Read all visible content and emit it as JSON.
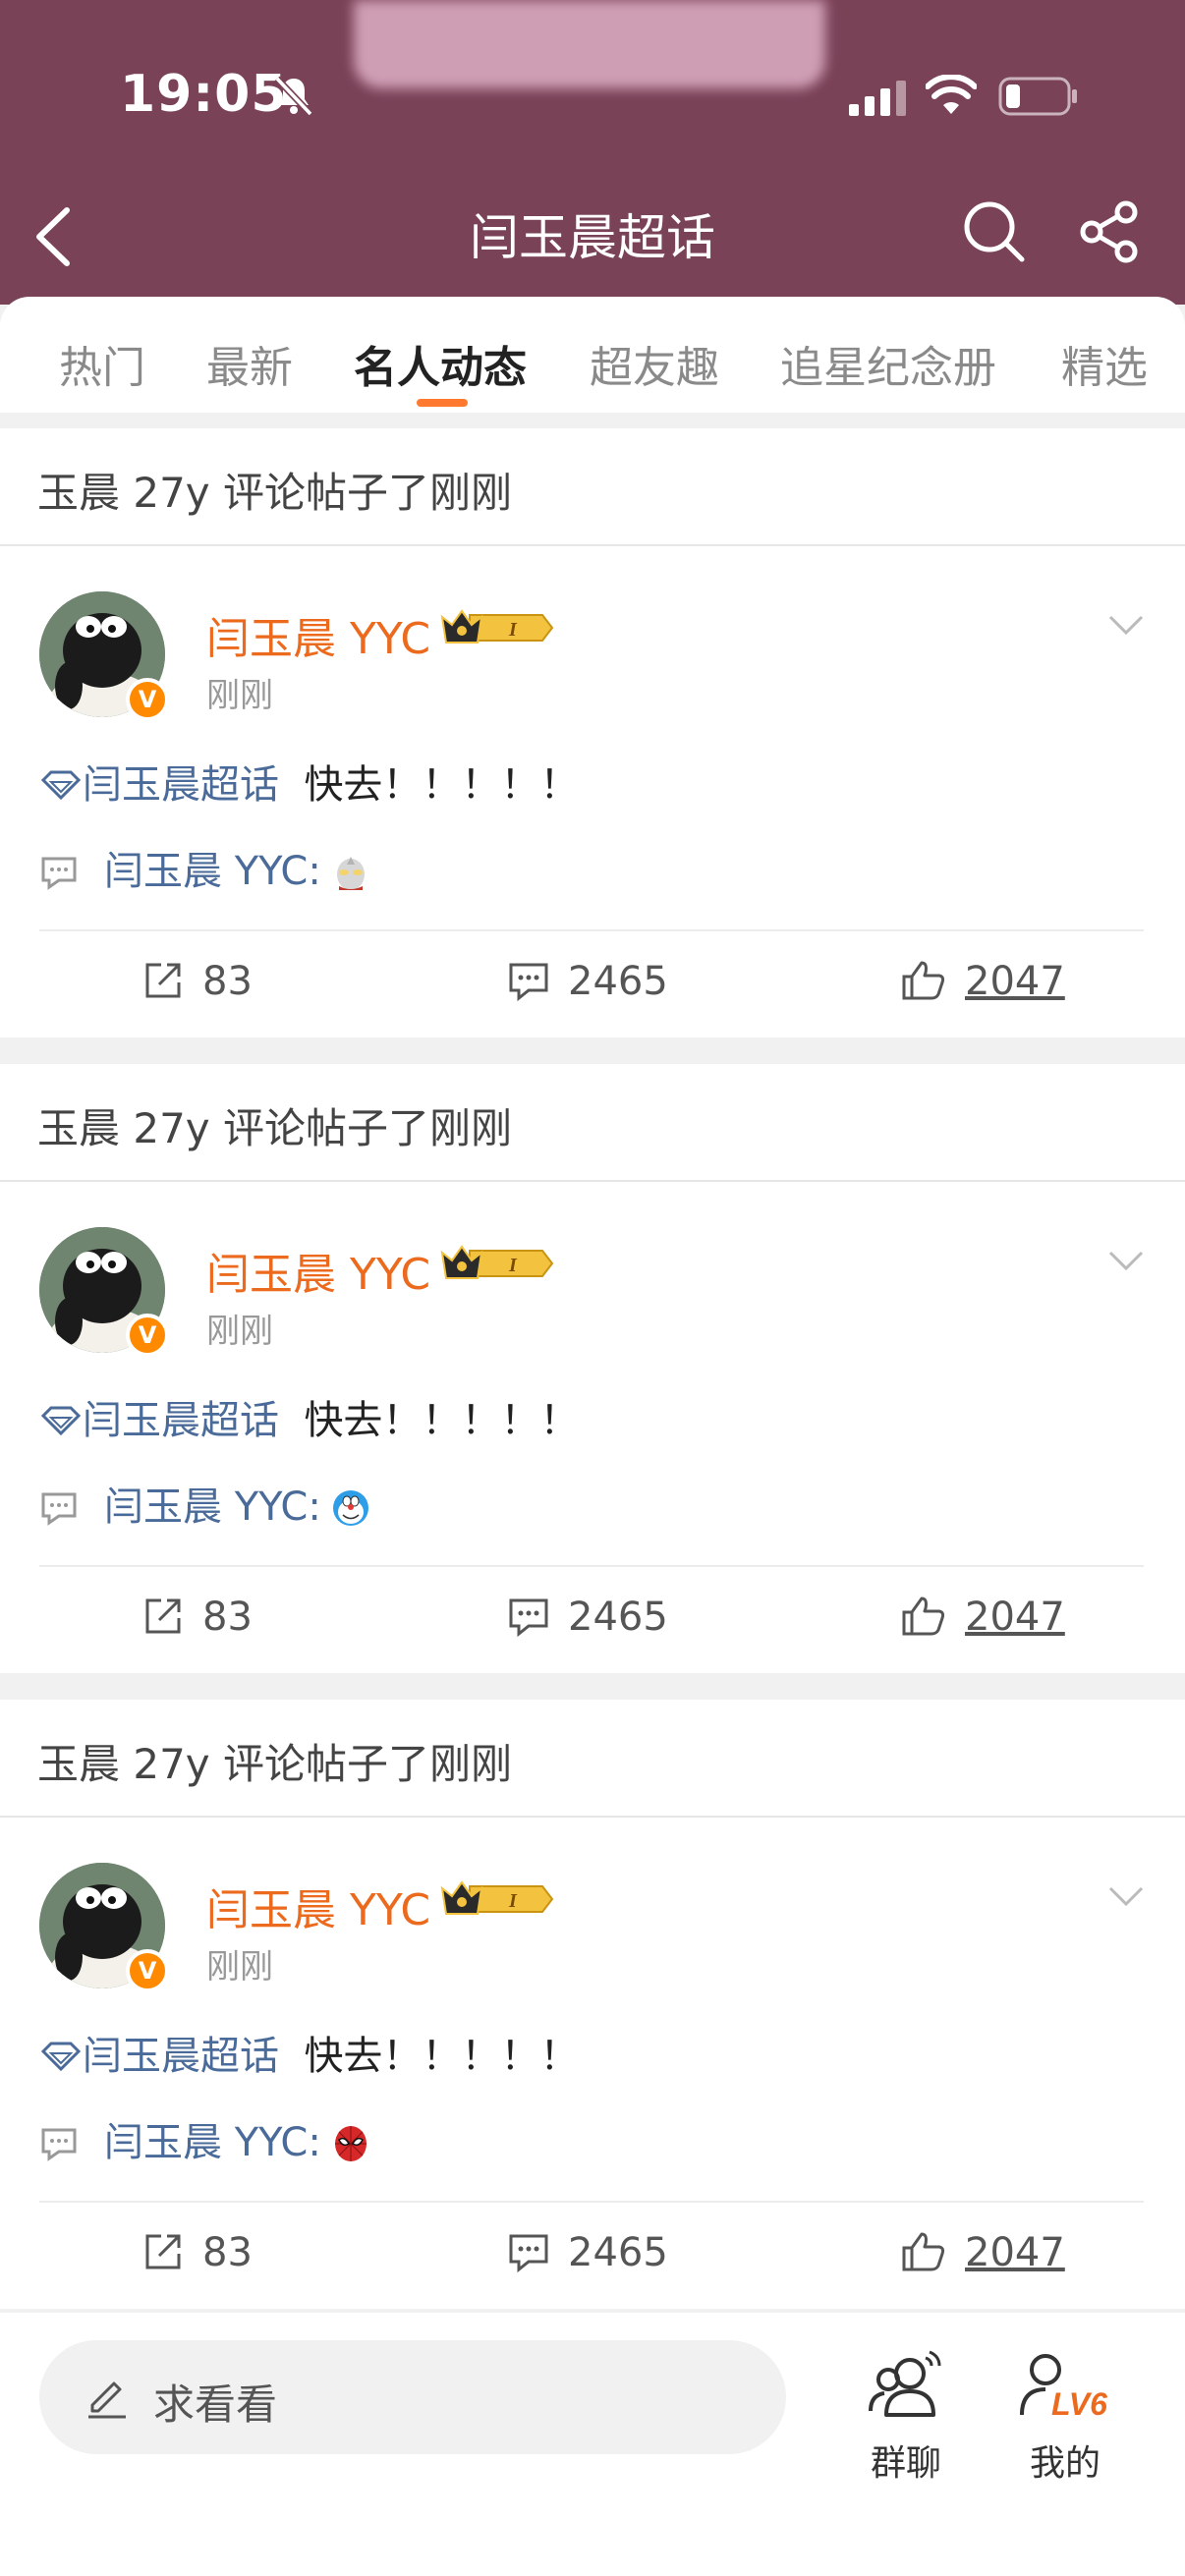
{
  "status_bar": {
    "time": "19:05"
  },
  "header": {
    "title": "闫玉晨超话"
  },
  "tabs": [
    {
      "label": "热门",
      "active": false
    },
    {
      "label": "最新",
      "active": false
    },
    {
      "label": "名人动态",
      "active": true
    },
    {
      "label": "超友趣",
      "active": false
    },
    {
      "label": "追星纪念册",
      "active": false
    },
    {
      "label": "精选",
      "active": false
    }
  ],
  "posts": [
    {
      "heading": "玉晨 27y 评论帖子了刚刚",
      "author": "闫玉晨 YYC",
      "time": "刚刚",
      "topic": "闫玉晨超话",
      "text": "快去！！！！！",
      "comment_author": "闫玉晨 YYC:",
      "emoji": "ultraman",
      "reposts": "83",
      "comments": "2465",
      "likes": "2047"
    },
    {
      "heading": "玉晨 27y 评论帖子了刚刚",
      "author": "闫玉晨 YYC",
      "time": "刚刚",
      "topic": "闫玉晨超话",
      "text": "快去！！！！！",
      "comment_author": "闫玉晨 YYC:",
      "emoji": "doraemon",
      "reposts": "83",
      "comments": "2465",
      "likes": "2047"
    },
    {
      "heading": "玉晨 27y 评论帖子了刚刚",
      "author": "闫玉晨 YYC",
      "time": "刚刚",
      "topic": "闫玉晨超话",
      "text": "快去！！！！！",
      "comment_author": "闫玉晨 YYC:",
      "emoji": "spiderman",
      "reposts": "83",
      "comments": "2465",
      "likes": "2047"
    }
  ],
  "bottom_bar": {
    "ask_placeholder": "求看看",
    "group_chat": "群聊",
    "mine": "我的",
    "level_badge": "LV6"
  },
  "colors": {
    "header_bg": "#7a4257",
    "accent_orange": "#eb6a1e",
    "tab_indicator": "#ff7a2f",
    "topic_blue": "#4a6b99"
  }
}
